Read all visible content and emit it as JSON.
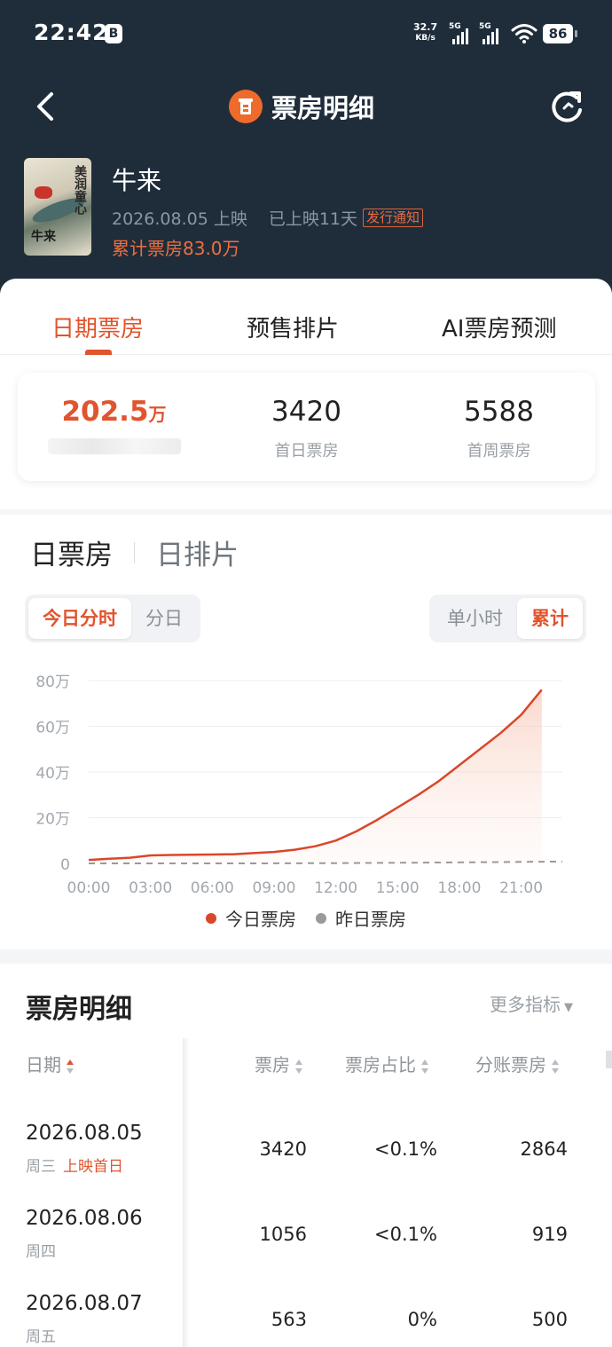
{
  "status_bar": {
    "time": "22:42",
    "notification_icon": "B",
    "net_speed": "32.7",
    "net_speed_unit": "KB/s",
    "signal_1_label": "5G",
    "signal_2_label": "5G",
    "battery": "86"
  },
  "nav": {
    "title": "票房明细"
  },
  "movie": {
    "title": "牛来",
    "release_date": "2026.08.05 上映",
    "days_released": "已上映11天",
    "badge": "发行通知",
    "total_box_office": "累计票房83.0万",
    "poster_calligraphy": "美润童心",
    "poster_name": "牛来"
  },
  "tabs": [
    "日期票房",
    "预售排片",
    "AI票房预测"
  ],
  "summary": {
    "realtime_value": "202.5",
    "realtime_unit": "万",
    "first_day_value": "3420",
    "first_day_label": "首日票房",
    "first_week_value": "5588",
    "first_week_label": "首周票房"
  },
  "chart_section": {
    "tab_active": "日票房",
    "tab_inactive": "日排片",
    "left_segment": [
      "今日分时",
      "分日"
    ],
    "right_segment": [
      "单小时",
      "累计"
    ],
    "legend": [
      "今日票房",
      "昨日票房"
    ]
  },
  "chart_data": {
    "type": "line",
    "x_ticks": [
      "00:00",
      "03:00",
      "06:00",
      "09:00",
      "12:00",
      "15:00",
      "18:00",
      "21:00"
    ],
    "y_ticks": [
      "0",
      "20万",
      "40万",
      "60万",
      "80万"
    ],
    "ylim": [
      0,
      80
    ],
    "y_unit": "万",
    "xlim": [
      0,
      23
    ],
    "series": [
      {
        "name": "今日票房",
        "color": "#d9472a",
        "area": true,
        "x": [
          0,
          1,
          2,
          3,
          4,
          5,
          6,
          7,
          8,
          9,
          10,
          11,
          12,
          13,
          14,
          15,
          16,
          17,
          18,
          19,
          20,
          21,
          22
        ],
        "values": [
          1.5,
          2.0,
          2.5,
          3.5,
          3.7,
          3.8,
          3.9,
          4.0,
          4.5,
          5.0,
          6.0,
          7.5,
          10.0,
          14.0,
          19.0,
          24.5,
          30.0,
          36.0,
          43.0,
          50.0,
          57.0,
          65.0,
          76.0
        ]
      },
      {
        "name": "昨日票房",
        "color": "#9a9a9a",
        "dashed": true,
        "x": [
          0,
          4,
          8,
          12,
          16,
          20,
          23
        ],
        "values": [
          0,
          0,
          0,
          0.1,
          0.3,
          0.6,
          0.8
        ]
      }
    ],
    "grid": true
  },
  "detail": {
    "title": "票房明细",
    "more": "更多指标",
    "columns": [
      "日期",
      "票房",
      "票房占比",
      "分账票房"
    ],
    "rows": [
      {
        "date": "2026.08.05",
        "weekday": "周三",
        "note": "上映首日",
        "box_office": "3420",
        "share": "<0.1%",
        "split": "2864"
      },
      {
        "date": "2026.08.06",
        "weekday": "周四",
        "note": "",
        "box_office": "1056",
        "share": "<0.1%",
        "split": "919"
      },
      {
        "date": "2026.08.07",
        "weekday": "周五",
        "note": "",
        "box_office": "563",
        "share": "0%",
        "split": "500"
      }
    ]
  },
  "colors": {
    "header_bg": "#1f2d3b",
    "accent": "#e1542d",
    "page_bg": "#f4f5f7"
  }
}
